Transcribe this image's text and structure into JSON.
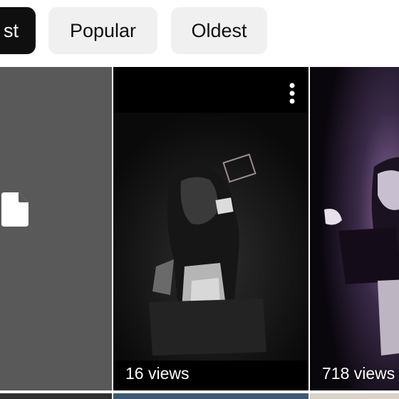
{
  "filters": {
    "selected_label": "st",
    "popular_label": "Popular",
    "oldest_label": "Oldest"
  },
  "videos": [
    {
      "views": ""
    },
    {
      "views": "16 views"
    },
    {
      "views": "718 views"
    }
  ],
  "icons": {
    "placeholder": "file-icon",
    "menu": "more-vert-icon"
  },
  "colors": {
    "chip_selected_bg": "#0f0f0f",
    "chip_bg": "#f0f0f0",
    "placeholder_bg": "#595959"
  }
}
